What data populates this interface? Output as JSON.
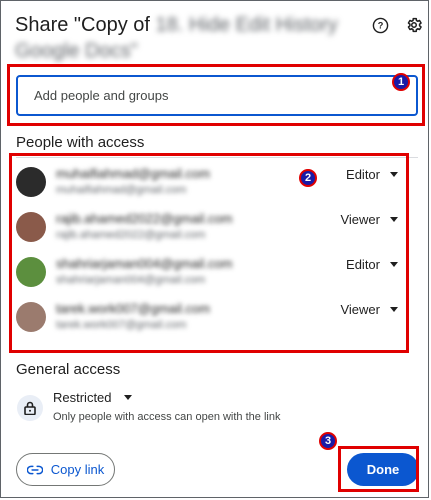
{
  "dialog": {
    "title_prefix": "Share \"Copy of",
    "title_blurred_line1": "18. Hide Edit History",
    "title_blurred_line2": "Google Docs\""
  },
  "header_icons": [
    "help-icon",
    "gear-icon"
  ],
  "add_people": {
    "placeholder": "Add people and groups"
  },
  "people_section": {
    "label": "People with access",
    "people": [
      {
        "email": "muhaifiahmad@gmail.com",
        "sub": "muhaifiahmad@gmail.com",
        "role": "Editor",
        "avatar_color": "#2b2b2b"
      },
      {
        "email": "rajib.ahamed2022@gmail.com",
        "sub": "rajib.ahamed2022@gmail.com",
        "role": "Viewer",
        "avatar_color": "#8a5a4a"
      },
      {
        "email": "shahriarjaman004@gmail.com",
        "sub": "shahriarjaman004@gmail.com",
        "role": "Editor",
        "avatar_color": "#5c8f3e"
      },
      {
        "email": "tarek.work007@gmail.com",
        "sub": "tarek.work007@gmail.com",
        "role": "Viewer",
        "avatar_color": "#9b7b6e"
      }
    ]
  },
  "general_access": {
    "label": "General access",
    "setting": "Restricted",
    "description": "Only people with access can open with the link"
  },
  "buttons": {
    "copy_link": "Copy link",
    "done": "Done"
  },
  "annotations": [
    "1",
    "2",
    "3"
  ],
  "colors": {
    "accent": "#0b57d0",
    "annotation_red": "#e00000"
  }
}
